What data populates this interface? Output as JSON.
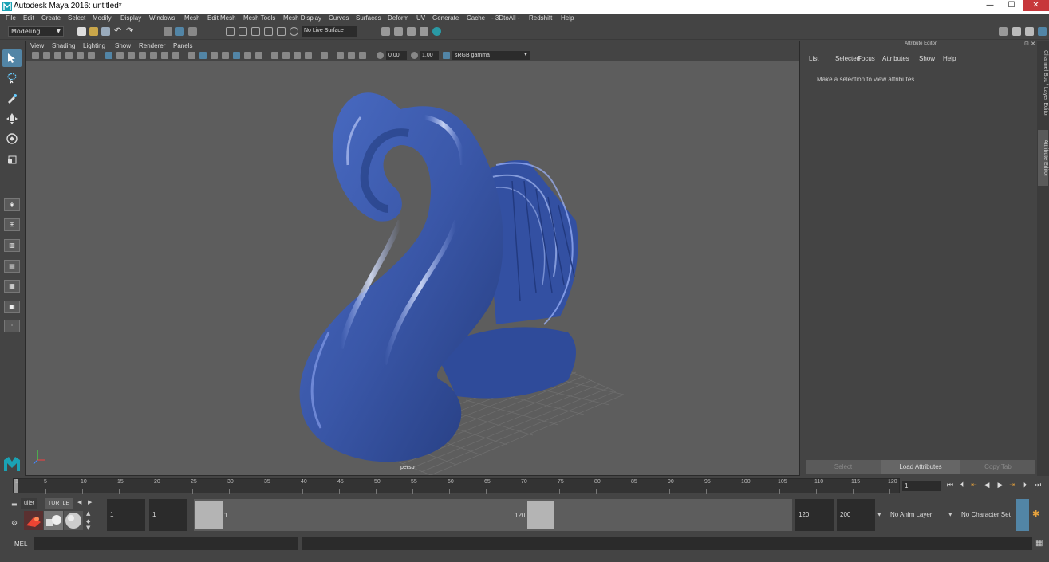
{
  "window": {
    "title": "Autodesk Maya 2016: untitled*",
    "minimize": "—",
    "maximize": "☐",
    "close": "✕"
  },
  "menubar": [
    "File",
    "Edit",
    "Create",
    "Select",
    "Modify",
    "Display",
    "Windows",
    "Mesh",
    "Edit Mesh",
    "Mesh Tools",
    "Mesh Display",
    "Curves",
    "Surfaces",
    "Deform",
    "UV",
    "Generate",
    "Cache",
    "- 3DtoAll -",
    "Redshift",
    "Help"
  ],
  "shelf": {
    "mode": "Modeling",
    "live_surface": "No Live Surface"
  },
  "panel": {
    "menus": [
      "View",
      "Shading",
      "Lighting",
      "Show",
      "Renderer",
      "Panels"
    ],
    "exposure": "0.00",
    "gamma": "1.00",
    "color_space": "sRGB gamma",
    "camera_label": "persp"
  },
  "attribute_editor": {
    "header": "Attribute Editor",
    "menus": [
      "List",
      "Selected",
      "Focus",
      "Attributes",
      "Show",
      "Help"
    ],
    "message": "Make a selection to view attributes",
    "buttons": [
      "Select",
      "Load Attributes",
      "Copy Tab"
    ]
  },
  "side_tabs": [
    "Channel Box / Layer Editor",
    "Attribute Editor"
  ],
  "timeline": {
    "ticks": [
      "1",
      "5",
      "10",
      "15",
      "20",
      "25",
      "30",
      "35",
      "40",
      "45",
      "50",
      "55",
      "60",
      "65",
      "70",
      "75",
      "80",
      "85",
      "90",
      "95",
      "100",
      "105",
      "110",
      "115",
      "120"
    ],
    "current_frame": "1"
  },
  "range": {
    "start": "1",
    "playback_start": "1",
    "slider_start": "1",
    "slider_end": "120",
    "playback_end": "120",
    "end": "200",
    "anim_layer": "No Anim Layer",
    "character_set": "No Character Set",
    "shelf_tabs": [
      "ullet",
      "TURTLE"
    ]
  },
  "command_line": {
    "label": "MEL"
  },
  "colors": {
    "accent": "#5285a6",
    "model": "#3f5fb0",
    "viewport_bg": "#5d5d5d"
  }
}
